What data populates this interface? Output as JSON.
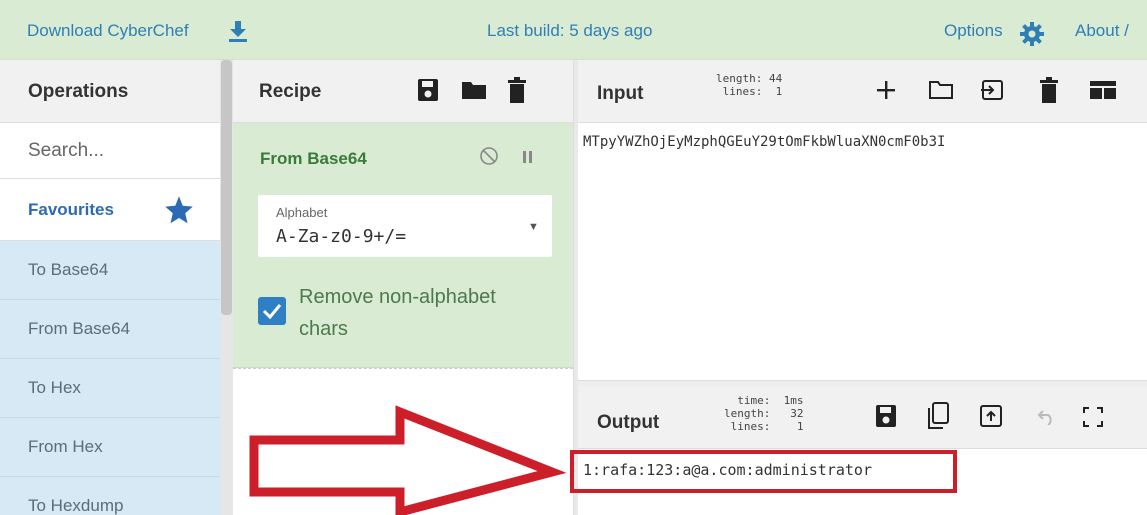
{
  "banner": {
    "download_label": "Download CyberChef",
    "last_build": "Last build: 5 days ago",
    "options_label": "Options",
    "about_label": "About /"
  },
  "operations": {
    "title": "Operations",
    "search_placeholder": "Search...",
    "favourites_label": "Favourites",
    "items": [
      "To Base64",
      "From Base64",
      "To Hex",
      "From Hex",
      "To Hexdump"
    ]
  },
  "recipe": {
    "title": "Recipe",
    "operation": {
      "name": "From Base64",
      "alphabet_label": "Alphabet",
      "alphabet_value": "A-Za-z0-9+/=",
      "remove_checkbox_label": "Remove non-alphabet chars",
      "remove_checked": true
    }
  },
  "input": {
    "title": "Input",
    "stats": "length: 44\n lines:  1",
    "text": "MTpyYWZhOjEyMzphQGEuY29tOmFkbWluaXN0cmF0b3I"
  },
  "output": {
    "title": "Output",
    "stats": "  time:  1ms\nlength:   32\n lines:    1",
    "text": "1:rafa:123:a@a.com:administrator"
  },
  "colors": {
    "banner_bg": "#d9ebd3",
    "recipe_op_bg": "#d9ebd3",
    "ops_item_bg": "#d6e9f4",
    "link_blue": "#2f7fb6",
    "annotation_red": "#cc1f2a"
  }
}
